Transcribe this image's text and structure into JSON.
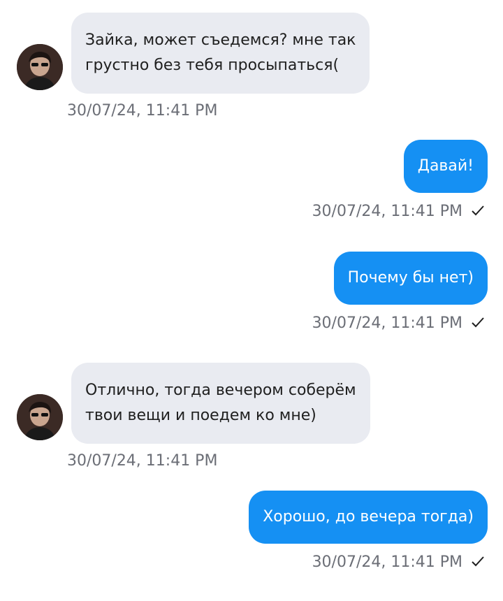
{
  "messages": [
    {
      "direction": "in",
      "text_line1": "Зайка, может съедемся? мне так",
      "text_line2": "грустно без тебя просыпаться(",
      "time": "30/07/24, 11:41 PM"
    },
    {
      "direction": "out",
      "text": "Давай!",
      "time": "30/07/24, 11:41 PM",
      "status_icon": "check-icon"
    },
    {
      "direction": "out",
      "text": "Почему бы нет)",
      "time": "30/07/24, 11:41 PM",
      "status_icon": "check-icon"
    },
    {
      "direction": "in",
      "text_line1": "Отлично, тогда вечером соберём",
      "text_line2": "твои вещи и поедем ко мне)",
      "time": "30/07/24, 11:41 PM"
    },
    {
      "direction": "out",
      "text": "Хорошо, до вечера тогда)",
      "time": "30/07/24, 11:41 PM",
      "status_icon": "check-icon"
    }
  ],
  "colors": {
    "incoming_bubble": "#e9ebf1",
    "outgoing_bubble": "#1590f3",
    "timestamp": "#6b6e76",
    "background": "#ffffff"
  },
  "icons": {
    "avatar": "avatar",
    "delivered": "check-icon"
  }
}
